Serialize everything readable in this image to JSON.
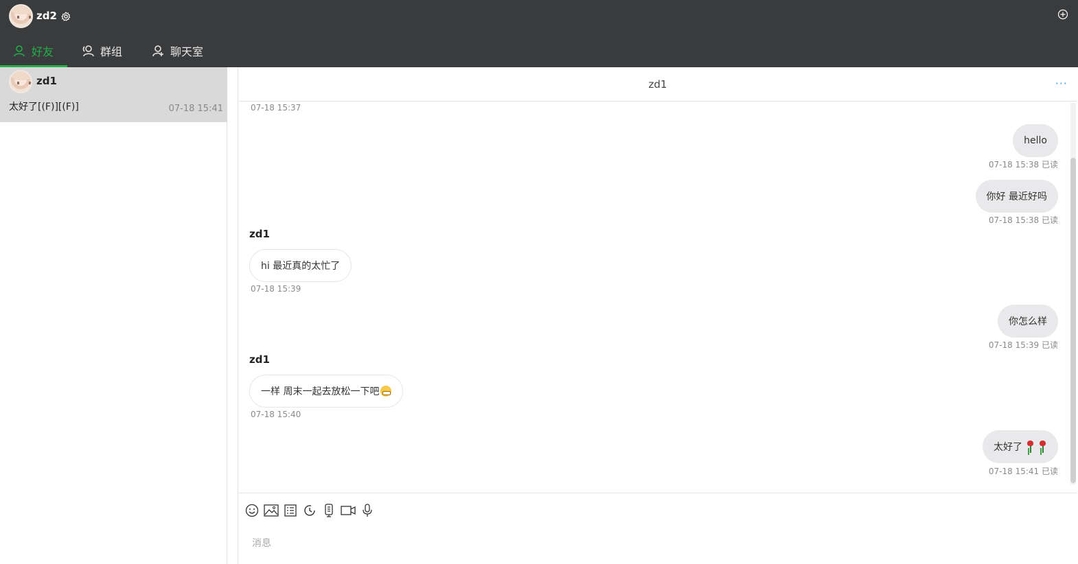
{
  "header": {
    "username": "zd2",
    "tabs": [
      {
        "label": "好友",
        "icon": "user-icon",
        "active": true
      },
      {
        "label": "群组",
        "icon": "group-icon",
        "active": false
      },
      {
        "label": "聊天室",
        "icon": "chatroom-icon",
        "active": false
      }
    ],
    "accent_color": "#22b04b"
  },
  "conversations": [
    {
      "name": "zd1",
      "last_message": "太好了[(F)][(F)]",
      "time": "07-18 15:41",
      "selected": true
    }
  ],
  "chat": {
    "title": "zd1",
    "more_label": "···",
    "top_timestamp": "07-18 15:37",
    "messages": [
      {
        "direction": "out",
        "text": "hello",
        "time": "07-18 15:38 已读"
      },
      {
        "direction": "out",
        "text": "你好 最近好吗",
        "time": "07-18 15:38 已读"
      },
      {
        "direction": "in",
        "sender": "zd1",
        "text": "hi 最近真的太忙了",
        "time": "07-18 15:39"
      },
      {
        "direction": "out",
        "text": "你怎么样",
        "time": "07-18 15:39 已读"
      },
      {
        "direction": "in",
        "sender": "zd1",
        "text": "一样 周末一起去放松一下吧",
        "emoji": "grimace-emoji",
        "time": "07-18 15:40"
      },
      {
        "direction": "out",
        "text": "太好了",
        "emoji": "rose-emoji x2",
        "time": "07-18 15:41 已读"
      }
    ],
    "input_placeholder": "消息",
    "toolbar_icons": [
      "emoji-icon",
      "image-icon",
      "file-icon",
      "history-icon",
      "phone-icon",
      "video-icon",
      "microphone-icon"
    ]
  }
}
